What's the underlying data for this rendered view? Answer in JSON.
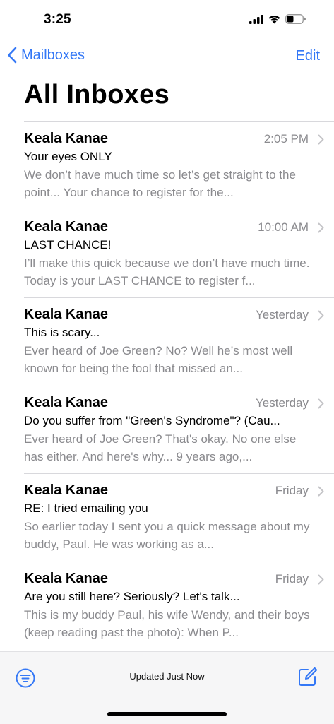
{
  "status_bar": {
    "time": "3:25"
  },
  "nav": {
    "back_label": "Mailboxes",
    "edit_label": "Edit"
  },
  "title": "All Inboxes",
  "messages": [
    {
      "sender": "Keala Kanae",
      "date": "2:05 PM",
      "subject": "Your eyes ONLY",
      "preview": "We don’t have much time so let’s get straight to the point... Your chance to register for the..."
    },
    {
      "sender": "Keala Kanae",
      "date": "10:00 AM",
      "subject": "LAST CHANCE!",
      "preview": "I’ll make this quick because we don’t have much time. Today is your LAST CHANCE to register f..."
    },
    {
      "sender": "Keala Kanae",
      "date": "Yesterday",
      "subject": "This is scary...",
      "preview": "Ever heard of Joe Green? No? Well he’s most well known for being the fool that missed an..."
    },
    {
      "sender": "Keala Kanae",
      "date": "Yesterday",
      "subject": "Do you suffer from \"Green's Syndrome\"? (Cau...",
      "preview": "Ever heard of Joe Green? That's okay. No one else has either. And here's why... 9 years ago,..."
    },
    {
      "sender": "Keala Kanae",
      "date": "Friday",
      "subject": "RE: I tried emailing you",
      "preview": "So earlier today I sent you a quick message about my buddy, Paul. He was working as a..."
    },
    {
      "sender": "Keala Kanae",
      "date": "Friday",
      "subject": "Are you still here? Seriously? Let's talk...",
      "preview": "This is my buddy Paul, his wife Wendy, and their boys (keep reading past the photo): When P..."
    }
  ],
  "toolbar": {
    "status": "Updated Just Now"
  },
  "colors": {
    "accent": "#3478f6",
    "secondary_text": "#8a8a8e",
    "separator": "#d8d8dc"
  },
  "icons": {
    "signal": "cellular-signal-icon",
    "wifi": "wifi-icon",
    "battery": "battery-icon",
    "back": "chevron-left-icon",
    "disclosure": "chevron-right-icon",
    "filter": "filter-icon",
    "compose": "compose-icon"
  }
}
